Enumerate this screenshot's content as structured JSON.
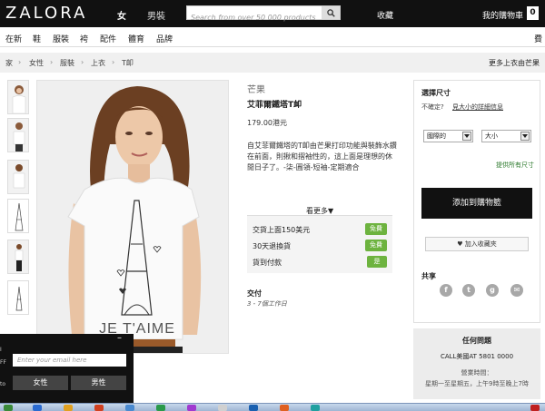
{
  "header": {
    "logo": "ZALORA",
    "gender_tabs": [
      {
        "label": "女",
        "active": true
      },
      {
        "label": "男裝",
        "active": false
      }
    ],
    "search_placeholder": "Search from over 50 000 products",
    "favorites_label": "收藏",
    "cart_label": "我的購物車",
    "cart_count": "0"
  },
  "category_nav": {
    "items": [
      "在新",
      "鞋",
      "服裝",
      "袴",
      "配件",
      "體育",
      "品牌"
    ],
    "right_fragment": "費"
  },
  "breadcrumb": {
    "items": [
      "家",
      "女性",
      "服裝",
      "上衣",
      "T卹"
    ],
    "more_link": "更多上衣由芒果"
  },
  "product": {
    "brand": "芒果",
    "name": "艾菲爾鐵塔T卹",
    "price": "179.00港元",
    "description": "自艾菲爾鐵塔的T卹由芒果打印功能與裝飾水鑽在前面，則揪和摺袖性的，這上面是理想的休閒日子了。-柒-圓領-短袖-定期適合",
    "see_more": "看更多▼",
    "perks": [
      {
        "label": "交貨上面150美元",
        "badge": "免費"
      },
      {
        "label": "30天退換貨",
        "badge": "免費"
      },
      {
        "label": "貨到付款",
        "badge": "是"
      }
    ],
    "delivery_title": "交付",
    "delivery_text": "3 - 7個工作日",
    "tshirt_print": "JE T'AIME"
  },
  "purchase_panel": {
    "size_title": "選擇尺寸",
    "size_question": "不確定?",
    "size_guide_link": "見大小的詳細信息",
    "region_select": "國際的",
    "size_select": "大小",
    "all_sizes": "提供所有尺寸",
    "add_to_cart": "添加到購物籃",
    "wishlist": "加入收藏夾",
    "share_title": "共享",
    "social_icons": [
      "facebook-icon",
      "twitter-icon",
      "google-plus-icon",
      "email-icon"
    ]
  },
  "help_box": {
    "title": "任何問題",
    "phone": "CALL美國AT 5801 0000",
    "hours_label": "營業時間：",
    "hours": "星期一至星期五，上午9時至晚上7時"
  },
  "newsletter": {
    "minimize": "–",
    "email_placeholder": "Enter your email here",
    "female_button": "女性",
    "male_button": "男性",
    "edge_text": [
      "I",
      "FF",
      "to"
    ]
  },
  "colors": {
    "header_bg": "#111111",
    "accent_green": "#6db33f",
    "cart_button_bg": "#111111"
  }
}
